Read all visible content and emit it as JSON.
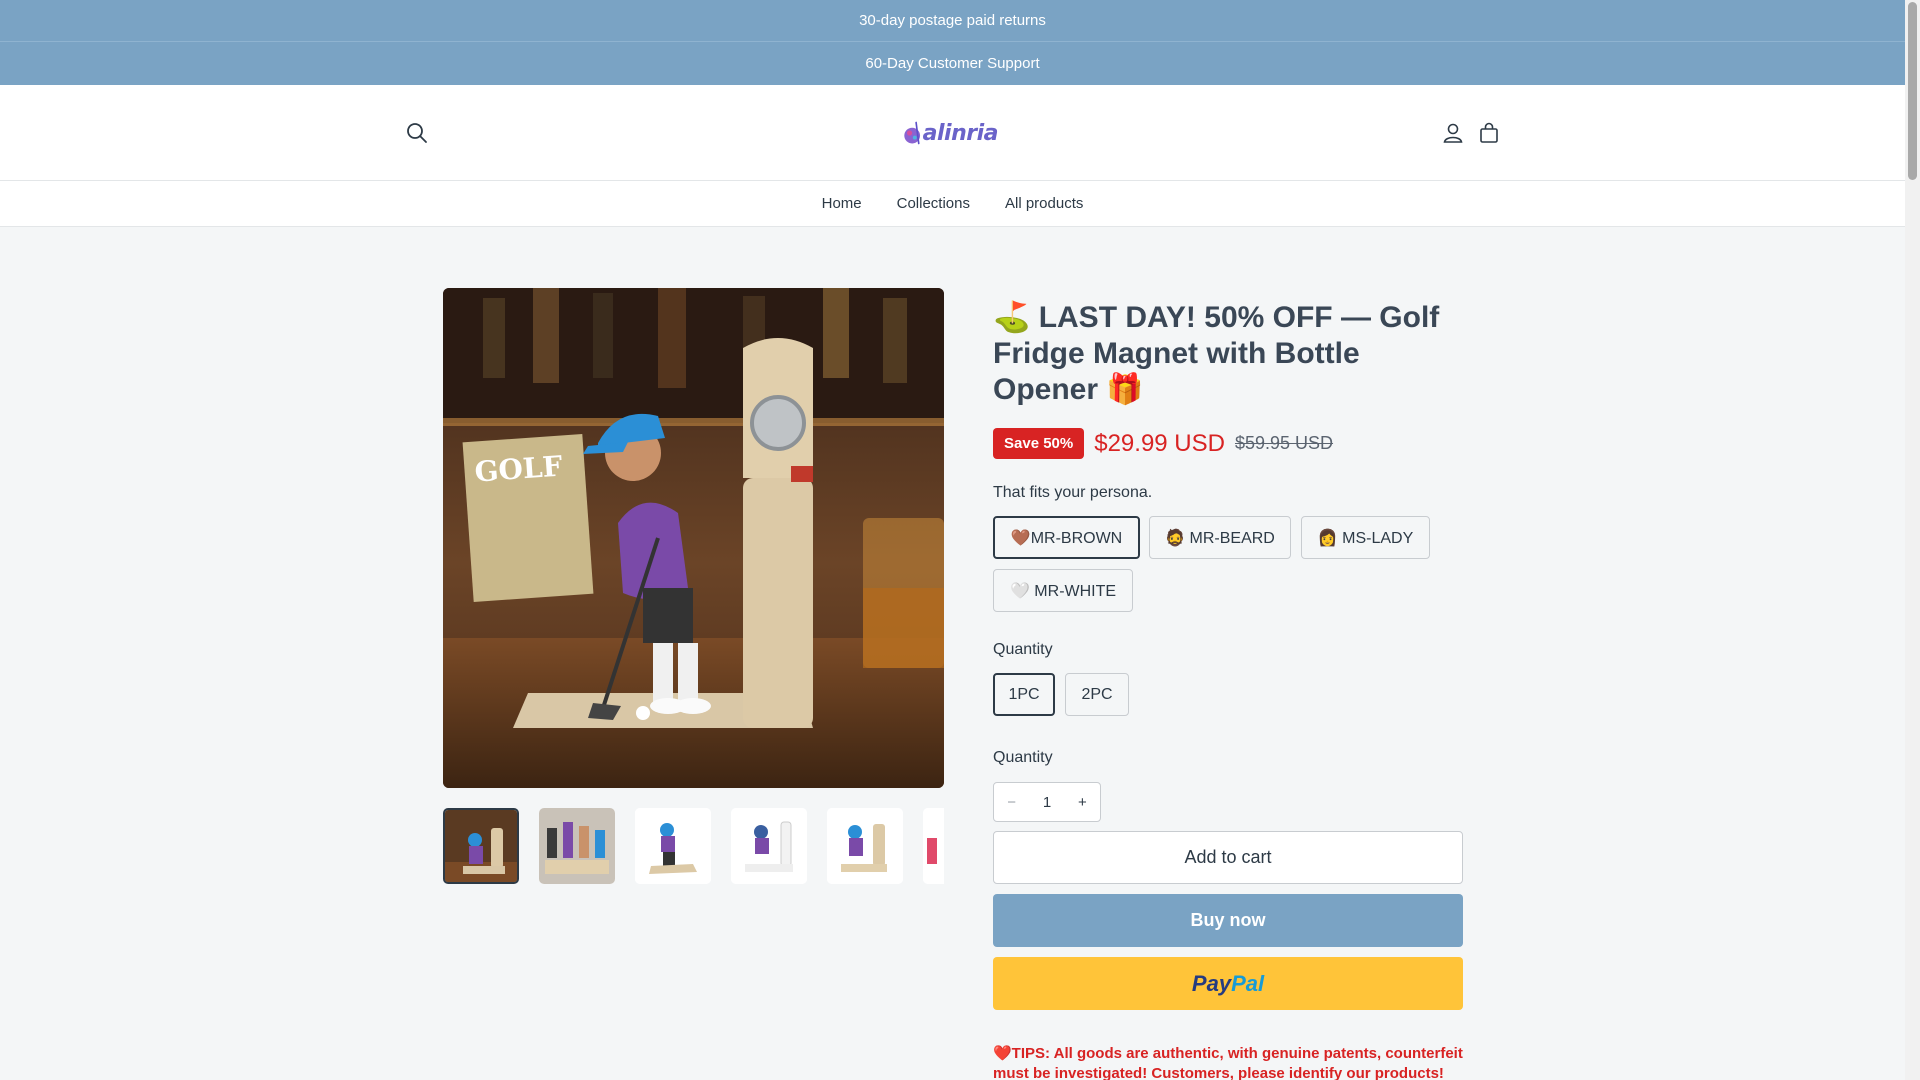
{
  "announcements": [
    "30-day postage paid returns",
    "60-Day Customer Support"
  ],
  "header": {
    "logo_text": "alinria"
  },
  "nav": {
    "items": [
      "Home",
      "Collections",
      "All products"
    ]
  },
  "product": {
    "title": "⛳ LAST DAY! 50% OFF — Golf Fridge Magnet with Bottle Opener 🎁",
    "save_badge": "Save 50%",
    "price_now": "$29.99 USD",
    "price_old": "$59.95 USD",
    "persona_label": "That fits your persona.",
    "persona_options": [
      "🤎MR-BROWN",
      "🧔 MR-BEARD",
      "👩 MS-LADY",
      "🤍 MR-WHITE"
    ],
    "persona_selected": "🤎MR-BROWN",
    "quantity_label": "Quantity",
    "pack_options": [
      "1PC",
      "2PC"
    ],
    "pack_selected": "1PC",
    "quantity_label_2": "Quantity",
    "quantity_value": "1",
    "minus": "−",
    "plus": "+",
    "add_to_cart": "Add to cart",
    "buy_now": "Buy now",
    "paypal_1": "Pay",
    "paypal_2": "Pal",
    "tips": "❤️TIPS: All goods are authentic, with genuine patents, counterfeit must be investigated! Customers, please identify our products!"
  },
  "colors": {
    "announcement_bg": "#7aa3c4",
    "sale_red": "#d82323",
    "buy_now_bg": "#7aa3c4",
    "paypal_yellow": "#ffc439",
    "text": "#2d3a46"
  },
  "icons": [
    "search-icon",
    "account-icon",
    "cart-icon",
    "golf-flag-icon",
    "gift-icon"
  ]
}
